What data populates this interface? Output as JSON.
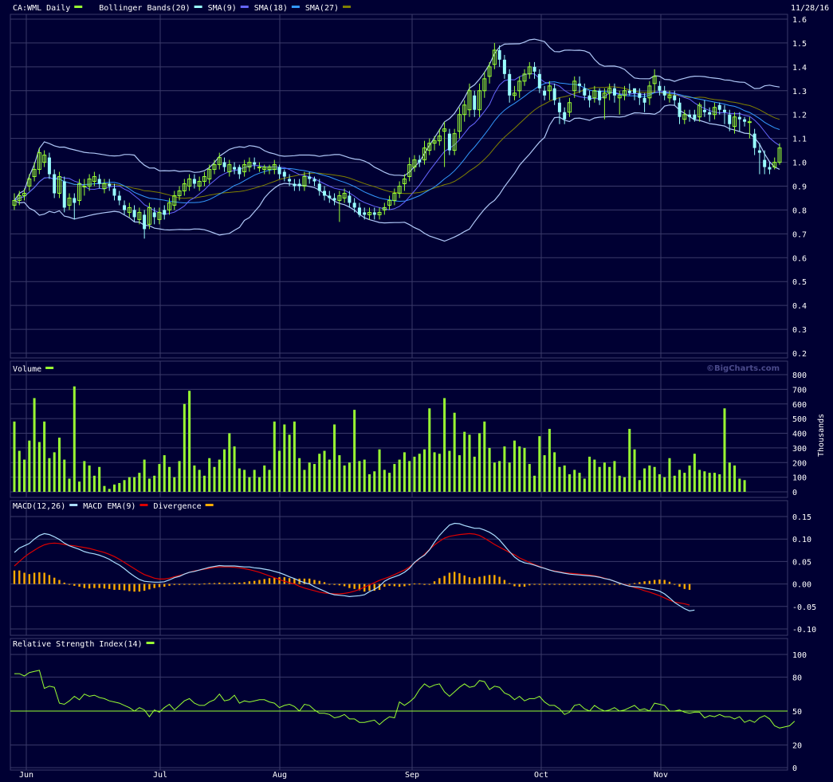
{
  "header": {
    "date": "11/28/16"
  },
  "colors": {
    "bg": "#000033",
    "grid": "#3a3a6a",
    "up": "#99ff33",
    "down": "#99ffff",
    "bb": "#b0c8f8",
    "sma9": "#6666ff",
    "sma18": "#3399ff",
    "sma27": "#808000",
    "macd": "#aaddff",
    "macd_ema": "#dd0000",
    "div": "#ffaa00",
    "rsi": "#99ff33",
    "rsi_line": "#99ff33"
  },
  "x_labels": [
    "Jun",
    "Jul",
    "Aug",
    "Sep",
    "Oct",
    "Nov"
  ],
  "copyright": "©BigCharts.com",
  "chart_data": [
    {
      "type": "candlestick",
      "legend": [
        {
          "text": "CA:WML Daily",
          "color": "#99ff33"
        },
        {
          "text": "Bollinger Bands(20)",
          "color": "#99ffff"
        },
        {
          "text": "SMA(9)",
          "color": "#6666ff"
        },
        {
          "text": "SMA(18)",
          "color": "#3399ff"
        },
        {
          "text": "SMA(27)",
          "color": "#808000"
        }
      ],
      "ylim": [
        0.2,
        1.6
      ],
      "yticks": [
        "1.6",
        "1.5",
        "1.4",
        "1.3",
        "1.2",
        "1.1",
        "1.0",
        "0.9",
        "0.8",
        "0.7",
        "0.6",
        "0.5",
        "0.4",
        "0.3",
        "0.2"
      ],
      "close": [
        0.84,
        0.86,
        0.87,
        0.93,
        0.97,
        1.04,
        1.03,
        0.95,
        0.87,
        0.94,
        0.81,
        0.85,
        0.83,
        0.91,
        0.9,
        0.93,
        0.94,
        0.91,
        0.91,
        0.9,
        0.86,
        0.84,
        0.8,
        0.81,
        0.77,
        0.79,
        0.72,
        0.81,
        0.77,
        0.79,
        0.78,
        0.83,
        0.86,
        0.88,
        0.91,
        0.93,
        0.91,
        0.92,
        0.94,
        0.97,
        0.99,
        1.02,
        0.98,
        0.99,
        0.97,
        0.95,
        0.99,
        1.0,
        0.99,
        0.98,
        0.98,
        0.98,
        0.99,
        0.95,
        0.94,
        0.92,
        0.9,
        0.9,
        0.94,
        0.93,
        0.92,
        0.88,
        0.86,
        0.85,
        0.84,
        0.86,
        0.87,
        0.83,
        0.81,
        0.78,
        0.78,
        0.79,
        0.78,
        0.79,
        0.81,
        0.84,
        0.87,
        0.9,
        0.93,
        0.99,
        1.01,
        1.0,
        1.06,
        1.08,
        1.09,
        1.11,
        1.14,
        1.05,
        1.12,
        1.2,
        1.24,
        1.3,
        1.22,
        1.3,
        1.35,
        1.4,
        1.47,
        1.43,
        1.37,
        1.28,
        1.29,
        1.34,
        1.37,
        1.4,
        1.38,
        1.31,
        1.28,
        1.32,
        1.26,
        1.21,
        1.18,
        1.25,
        1.34,
        1.32,
        1.28,
        1.26,
        1.3,
        1.26,
        1.29,
        1.31,
        1.28,
        1.28,
        1.3,
        1.29,
        1.29,
        1.27,
        1.25,
        1.32,
        1.36,
        1.3,
        1.28,
        1.28,
        1.26,
        1.19,
        1.2,
        1.19,
        1.18,
        1.24,
        1.21,
        1.2,
        1.23,
        1.22,
        1.21,
        1.16,
        1.19,
        1.18,
        1.17,
        1.17,
        1.06,
        1.04,
        0.98,
        0.97,
        1.0,
        1.06
      ],
      "open": [
        0.82,
        0.84,
        0.86,
        0.9,
        0.94,
        0.97,
        1.0,
        1.02,
        0.95,
        0.87,
        0.92,
        0.82,
        0.85,
        0.84,
        0.9,
        0.9,
        0.92,
        0.93,
        0.89,
        0.91,
        0.89,
        0.86,
        0.82,
        0.79,
        0.8,
        0.76,
        0.78,
        0.74,
        0.79,
        0.76,
        0.8,
        0.8,
        0.82,
        0.86,
        0.88,
        0.9,
        0.93,
        0.9,
        0.92,
        0.93,
        0.97,
        0.99,
        1.0,
        0.96,
        0.98,
        0.98,
        0.96,
        0.98,
        1.0,
        0.98,
        0.97,
        0.97,
        0.97,
        0.98,
        0.96,
        0.93,
        0.91,
        0.91,
        0.9,
        0.94,
        0.93,
        0.91,
        0.88,
        0.86,
        0.85,
        0.84,
        0.85,
        0.86,
        0.83,
        0.81,
        0.79,
        0.78,
        0.79,
        0.78,
        0.8,
        0.82,
        0.84,
        0.87,
        0.91,
        0.94,
        0.98,
        1.01,
        1.01,
        1.05,
        1.08,
        1.09,
        1.13,
        1.12,
        1.05,
        1.13,
        1.2,
        1.22,
        1.28,
        1.22,
        1.3,
        1.36,
        1.41,
        1.47,
        1.43,
        1.37,
        1.28,
        1.3,
        1.34,
        1.37,
        1.4,
        1.37,
        1.3,
        1.3,
        1.31,
        1.25,
        1.21,
        1.21,
        1.3,
        1.33,
        1.31,
        1.28,
        1.27,
        1.3,
        1.27,
        1.29,
        1.31,
        1.27,
        1.28,
        1.3,
        1.31,
        1.29,
        1.27,
        1.27,
        1.33,
        1.32,
        1.3,
        1.27,
        1.28,
        1.25,
        1.18,
        1.2,
        1.2,
        1.19,
        1.22,
        1.21,
        1.2,
        1.24,
        1.22,
        1.2,
        1.15,
        1.19,
        1.18,
        1.17,
        1.12,
        1.05,
        1.01,
        0.98,
        0.98,
        1.0
      ],
      "high": [
        0.87,
        0.88,
        0.89,
        0.95,
        1.0,
        1.06,
        1.05,
        1.04,
        0.97,
        0.96,
        0.94,
        0.87,
        0.87,
        0.93,
        0.93,
        0.95,
        0.96,
        0.95,
        0.93,
        0.93,
        0.91,
        0.88,
        0.84,
        0.83,
        0.82,
        0.81,
        0.8,
        0.83,
        0.81,
        0.81,
        0.82,
        0.85,
        0.88,
        0.9,
        0.93,
        0.95,
        0.95,
        0.94,
        0.96,
        0.99,
        1.01,
        1.04,
        1.02,
        1.01,
        1.0,
        0.99,
        1.01,
        1.02,
        1.02,
        1.0,
        0.99,
        0.99,
        1.01,
        0.99,
        0.97,
        0.95,
        0.93,
        0.93,
        0.96,
        0.96,
        0.94,
        0.93,
        0.9,
        0.88,
        0.87,
        0.88,
        0.89,
        0.88,
        0.85,
        0.83,
        0.81,
        0.81,
        0.81,
        0.81,
        0.83,
        0.86,
        0.89,
        0.92,
        0.95,
        1.02,
        1.03,
        1.03,
        1.09,
        1.1,
        1.11,
        1.14,
        1.17,
        1.14,
        1.14,
        1.23,
        1.26,
        1.33,
        1.3,
        1.33,
        1.38,
        1.42,
        1.5,
        1.49,
        1.45,
        1.39,
        1.32,
        1.36,
        1.39,
        1.42,
        1.42,
        1.39,
        1.32,
        1.34,
        1.33,
        1.27,
        1.23,
        1.27,
        1.36,
        1.36,
        1.33,
        1.3,
        1.32,
        1.31,
        1.31,
        1.33,
        1.33,
        1.3,
        1.32,
        1.33,
        1.31,
        1.31,
        1.29,
        1.34,
        1.39,
        1.34,
        1.32,
        1.3,
        1.3,
        1.27,
        1.22,
        1.22,
        1.22,
        1.25,
        1.26,
        1.23,
        1.25,
        1.25,
        1.24,
        1.22,
        1.21,
        1.21,
        1.19,
        1.19,
        1.14,
        1.08,
        1.05,
        1.0,
        1.02,
        1.08
      ],
      "low": [
        0.8,
        0.82,
        0.84,
        0.88,
        0.92,
        0.95,
        0.98,
        0.93,
        0.85,
        0.85,
        0.79,
        0.8,
        0.76,
        0.82,
        0.86,
        0.88,
        0.9,
        0.89,
        0.87,
        0.88,
        0.84,
        0.82,
        0.78,
        0.77,
        0.75,
        0.74,
        0.68,
        0.72,
        0.74,
        0.74,
        0.76,
        0.78,
        0.8,
        0.84,
        0.86,
        0.88,
        0.89,
        0.88,
        0.9,
        0.91,
        0.95,
        0.97,
        0.96,
        0.94,
        0.95,
        0.93,
        0.94,
        0.96,
        0.97,
        0.96,
        0.95,
        0.95,
        0.95,
        0.93,
        0.92,
        0.9,
        0.88,
        0.88,
        0.88,
        0.91,
        0.9,
        0.86,
        0.84,
        0.83,
        0.82,
        0.75,
        0.83,
        0.81,
        0.79,
        0.77,
        0.76,
        0.76,
        0.76,
        0.76,
        0.78,
        0.8,
        0.82,
        0.85,
        0.88,
        0.92,
        0.96,
        0.98,
        0.99,
        1.03,
        1.05,
        1.07,
        0.98,
        1.03,
        1.03,
        1.1,
        1.17,
        1.19,
        1.19,
        1.19,
        1.27,
        1.33,
        1.39,
        1.4,
        1.35,
        1.25,
        1.26,
        1.27,
        1.32,
        1.35,
        1.35,
        1.29,
        1.26,
        1.26,
        1.24,
        1.16,
        1.16,
        1.19,
        1.27,
        1.29,
        1.26,
        1.23,
        1.25,
        1.24,
        1.18,
        1.26,
        1.25,
        1.2,
        1.26,
        1.28,
        1.26,
        1.24,
        1.21,
        1.24,
        1.29,
        1.28,
        1.26,
        1.25,
        1.24,
        1.16,
        1.16,
        1.17,
        1.17,
        1.17,
        1.19,
        1.17,
        1.18,
        1.2,
        1.16,
        1.13,
        1.12,
        1.13,
        1.15,
        1.1,
        1.03,
        0.95,
        0.95,
        0.95,
        0.97,
        0.99
      ]
    },
    {
      "type": "bar",
      "legend": [
        {
          "text": "Volume",
          "color": "#99ff33"
        }
      ],
      "ylabel": "Thousands",
      "ylim": [
        0,
        800
      ],
      "yticks": [
        "800",
        "700",
        "600",
        "500",
        "400",
        "300",
        "200",
        "100",
        "0"
      ],
      "values": [
        480,
        280,
        220,
        350,
        640,
        340,
        480,
        230,
        270,
        370,
        220,
        90,
        720,
        70,
        210,
        180,
        110,
        170,
        40,
        20,
        50,
        60,
        80,
        100,
        100,
        130,
        220,
        90,
        110,
        190,
        250,
        170,
        100,
        210,
        600,
        690,
        180,
        150,
        110,
        230,
        170,
        220,
        290,
        400,
        310,
        160,
        150,
        100,
        150,
        100,
        180,
        150,
        480,
        280,
        460,
        390,
        480,
        230,
        150,
        200,
        190,
        260,
        280,
        220,
        460,
        250,
        180,
        200,
        560,
        210,
        220,
        120,
        140,
        290,
        150,
        130,
        190,
        220,
        270,
        210,
        240,
        260,
        290,
        570,
        270,
        260,
        640,
        280,
        540,
        250,
        410,
        390,
        240,
        400,
        480,
        300,
        200,
        210,
        310,
        200,
        350,
        310,
        300,
        190,
        110,
        380,
        250,
        430,
        270,
        170,
        180,
        120,
        150,
        130,
        90,
        240,
        220,
        170,
        200,
        170,
        210,
        110,
        100,
        430,
        290,
        80,
        160,
        180,
        170,
        120,
        100,
        230,
        110,
        150,
        130,
        180,
        260,
        150,
        140,
        130,
        130,
        120,
        570,
        200,
        180,
        90,
        80
      ],
      "copyright": "©BigCharts.com"
    },
    {
      "type": "line",
      "legend": [
        {
          "text": "MACD(12,26)",
          "color": "#aaddff"
        },
        {
          "text": "MACD EMA(9)",
          "color": "#dd0000"
        },
        {
          "text": "Divergence",
          "color": "#ffaa00"
        }
      ],
      "ylim": [
        -0.1,
        0.15
      ],
      "yticks": [
        "0.15",
        "0.10",
        "0.05",
        "0.00",
        "-0.05",
        "-0.10"
      ],
      "macd": [
        0.07,
        0.08,
        0.085,
        0.09,
        0.1,
        0.108,
        0.112,
        0.11,
        0.105,
        0.099,
        0.091,
        0.085,
        0.081,
        0.077,
        0.072,
        0.069,
        0.067,
        0.064,
        0.06,
        0.055,
        0.048,
        0.042,
        0.034,
        0.025,
        0.017,
        0.01,
        0.006,
        0.005,
        0.004,
        0.004,
        0.005,
        0.009,
        0.014,
        0.017,
        0.022,
        0.026,
        0.028,
        0.031,
        0.034,
        0.037,
        0.039,
        0.041,
        0.04,
        0.04,
        0.04,
        0.039,
        0.038,
        0.038,
        0.036,
        0.035,
        0.033,
        0.031,
        0.028,
        0.025,
        0.021,
        0.016,
        0.012,
        0.007,
        0.003,
        0.0,
        -0.006,
        -0.011,
        -0.016,
        -0.021,
        -0.024,
        -0.025,
        -0.026,
        -0.028,
        -0.027,
        -0.026,
        -0.024,
        -0.017,
        -0.012,
        -0.005,
        0.006,
        0.012,
        0.016,
        0.02,
        0.026,
        0.035,
        0.048,
        0.057,
        0.064,
        0.076,
        0.093,
        0.108,
        0.12,
        0.131,
        0.135,
        0.134,
        0.13,
        0.127,
        0.124,
        0.124,
        0.12,
        0.115,
        0.108,
        0.098,
        0.085,
        0.072,
        0.06,
        0.052,
        0.047,
        0.045,
        0.042,
        0.038,
        0.035,
        0.031,
        0.028,
        0.026,
        0.024,
        0.022,
        0.021,
        0.02,
        0.019,
        0.018,
        0.017,
        0.015,
        0.012,
        0.01,
        0.006,
        0.002,
        -0.002,
        -0.005,
        -0.006,
        -0.007,
        -0.009,
        -0.011,
        -0.013,
        -0.016,
        -0.022,
        -0.031,
        -0.041,
        -0.048,
        -0.055,
        -0.06,
        -0.058
      ],
      "ema": [
        0.04,
        0.05,
        0.06,
        0.068,
        0.075,
        0.082,
        0.087,
        0.09,
        0.091,
        0.09,
        0.088,
        0.086,
        0.085,
        0.083,
        0.081,
        0.079,
        0.076,
        0.073,
        0.07,
        0.066,
        0.061,
        0.055,
        0.048,
        0.041,
        0.034,
        0.027,
        0.021,
        0.017,
        0.013,
        0.011,
        0.011,
        0.013,
        0.016,
        0.019,
        0.022,
        0.026,
        0.029,
        0.031,
        0.033,
        0.035,
        0.037,
        0.038,
        0.038,
        0.038,
        0.037,
        0.036,
        0.034,
        0.032,
        0.029,
        0.026,
        0.022,
        0.018,
        0.014,
        0.01,
        0.006,
        0.003,
        0.0,
        -0.005,
        -0.009,
        -0.012,
        -0.015,
        -0.018,
        -0.02,
        -0.021,
        -0.022,
        -0.022,
        -0.021,
        -0.019,
        -0.016,
        -0.012,
        -0.007,
        -0.002,
        0.003,
        0.008,
        0.012,
        0.016,
        0.021,
        0.026,
        0.031,
        0.038,
        0.047,
        0.056,
        0.066,
        0.077,
        0.087,
        0.095,
        0.102,
        0.106,
        0.108,
        0.11,
        0.111,
        0.112,
        0.111,
        0.108,
        0.102,
        0.095,
        0.088,
        0.082,
        0.076,
        0.07,
        0.065,
        0.058,
        0.053,
        0.048,
        0.043,
        0.039,
        0.035,
        0.031,
        0.029,
        0.027,
        0.025,
        0.024,
        0.023,
        0.022,
        0.021,
        0.02,
        0.018,
        0.016,
        0.013,
        0.01,
        0.006,
        0.002,
        -0.001,
        -0.004,
        -0.008,
        -0.011,
        -0.015,
        -0.018,
        -0.022,
        -0.026,
        -0.031,
        -0.036,
        -0.04,
        -0.042,
        -0.044,
        -0.047
      ]
    },
    {
      "type": "line",
      "legend": [
        {
          "text": "Relative Strength Index(14)",
          "color": "#99ff33"
        }
      ],
      "ylim": [
        0,
        100
      ],
      "yticks": [
        "100",
        "80",
        "50",
        "20",
        "0"
      ],
      "reference": 50,
      "values": [
        83,
        83,
        81,
        84,
        85,
        86,
        70,
        72,
        71,
        57,
        56,
        59,
        63,
        60,
        65,
        63,
        64,
        62,
        61,
        59,
        58,
        57,
        55,
        53,
        50,
        53,
        51,
        45,
        51,
        49,
        53,
        56,
        51,
        55,
        59,
        61,
        57,
        55,
        55,
        58,
        60,
        65,
        59,
        60,
        64,
        57,
        59,
        58,
        59,
        60,
        60,
        58,
        57,
        53,
        55,
        56,
        54,
        50,
        56,
        55,
        51,
        48,
        48,
        47,
        44,
        45,
        47,
        43,
        43,
        40,
        40,
        41,
        42,
        38,
        42,
        45,
        44,
        58,
        55,
        58,
        62,
        69,
        74,
        71,
        73,
        74,
        67,
        63,
        67,
        71,
        74,
        71,
        72,
        77,
        76,
        69,
        72,
        71,
        66,
        64,
        60,
        63,
        59,
        61,
        61,
        63,
        58,
        55,
        55,
        52,
        47,
        49,
        55,
        56,
        52,
        50,
        55,
        52,
        50,
        51,
        53,
        50,
        51,
        53,
        55,
        51,
        52,
        50,
        57,
        56,
        55,
        50,
        50,
        51,
        49,
        48,
        49,
        49,
        44,
        46,
        45,
        47,
        45,
        45,
        43,
        45,
        40,
        42,
        40,
        44,
        46,
        43,
        37,
        35,
        36,
        37,
        41
      ]
    }
  ]
}
